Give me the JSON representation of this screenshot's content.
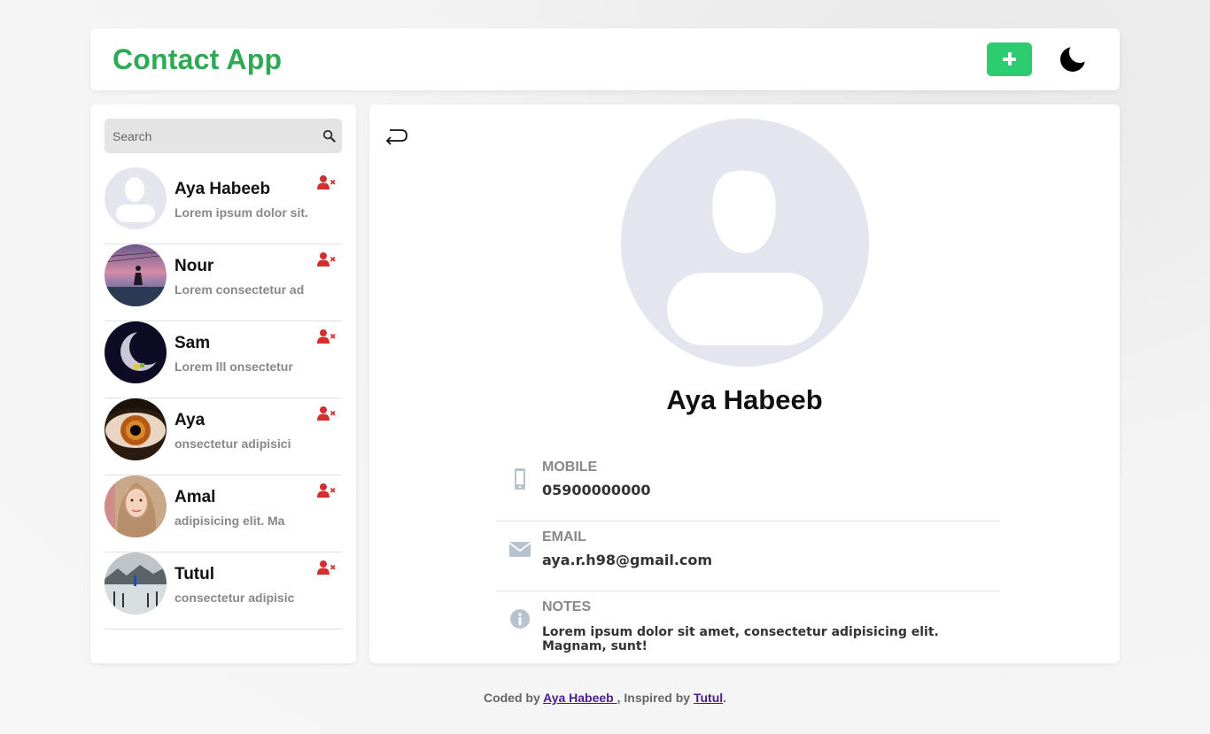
{
  "header": {
    "title": "Contact App",
    "add_button_icon": "plus-icon",
    "theme_toggle_icon": "moon-icon",
    "accent_color": "#2eaa54",
    "add_button_color": "#2ecc71"
  },
  "sidebar": {
    "search": {
      "placeholder": "Search",
      "value": "",
      "icon": "search-icon"
    },
    "contacts": [
      {
        "name": "Aya Habeeb",
        "desc": "Lorem ipsum dolor sit.",
        "avatar": "default-avatar"
      },
      {
        "name": "Nour",
        "desc": "Lorem consectetur ad",
        "avatar": "sunset-photo"
      },
      {
        "name": "Sam",
        "desc": "Lorem lll onsectetur",
        "avatar": "moon-photo"
      },
      {
        "name": "Aya",
        "desc": "onsectetur adipisici",
        "avatar": "eye-photo"
      },
      {
        "name": "Amal",
        "desc": "adipisicing elit. Ma",
        "avatar": "portrait-photo"
      },
      {
        "name": "Tutul",
        "desc": "consectetur adipisic",
        "avatar": "pier-photo"
      }
    ],
    "delete_icon": "user-remove-icon",
    "delete_color": "#d32f2f"
  },
  "detail": {
    "back_icon": "back-arrow-icon",
    "name": "Aya Habeeb",
    "fields": {
      "mobile": {
        "label": "MOBILE",
        "value": "05900000000",
        "icon": "mobile-icon"
      },
      "email": {
        "label": "EMAIL",
        "value": "aya.r.h98@gmail.com",
        "icon": "envelope-icon"
      },
      "notes": {
        "label": "NOTES",
        "value": "Lorem ipsum dolor sit amet, consectetur adipisicing elit. Magnam, sunt!",
        "icon": "info-icon"
      }
    }
  },
  "footer": {
    "prefix": "Coded by",
    "author": "Aya Habeeb ",
    "middle": ", Inspired by",
    "inspiration": "Tutul",
    "suffix": "."
  }
}
